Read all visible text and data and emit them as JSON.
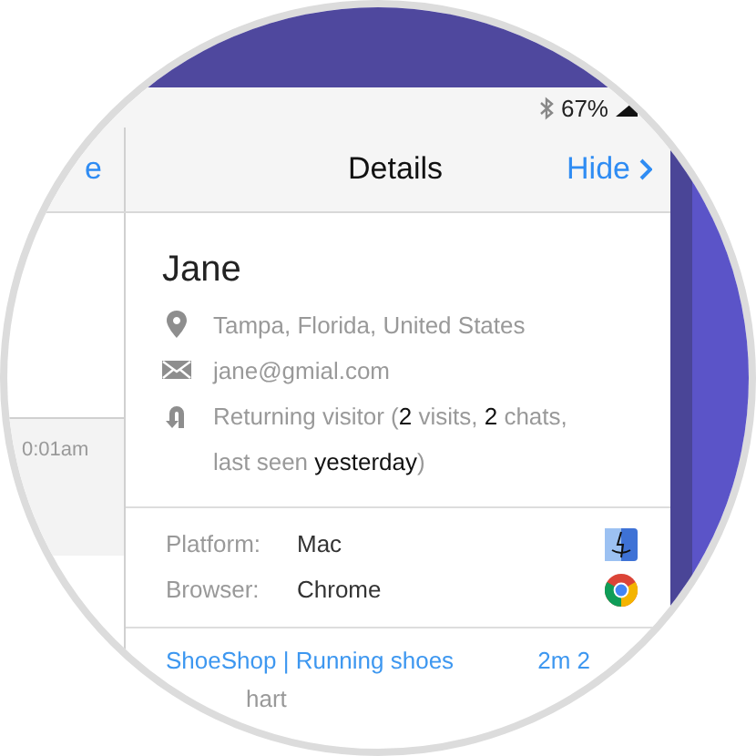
{
  "status_bar": {
    "battery": "67%"
  },
  "nav": {
    "back_partial": "e",
    "title": "Details",
    "action": "Hide"
  },
  "list": {
    "time": "0:01am"
  },
  "visitor": {
    "name": "Jane",
    "location": "Tampa, Florida, United States",
    "email": "jane@gmial.com",
    "history": "Returning visitor (**2** visits, **2** chats, last seen **yesterday**)"
  },
  "system": [
    {
      "label": "Platform:",
      "value": "Mac",
      "kind": "finder"
    },
    {
      "label": "Browser:",
      "value": "Chrome",
      "kind": "chrome"
    }
  ],
  "pages": [
    {
      "title": "ShoeShop | Running shoes",
      "duration": "2m 2"
    }
  ],
  "partial_line": "hart"
}
